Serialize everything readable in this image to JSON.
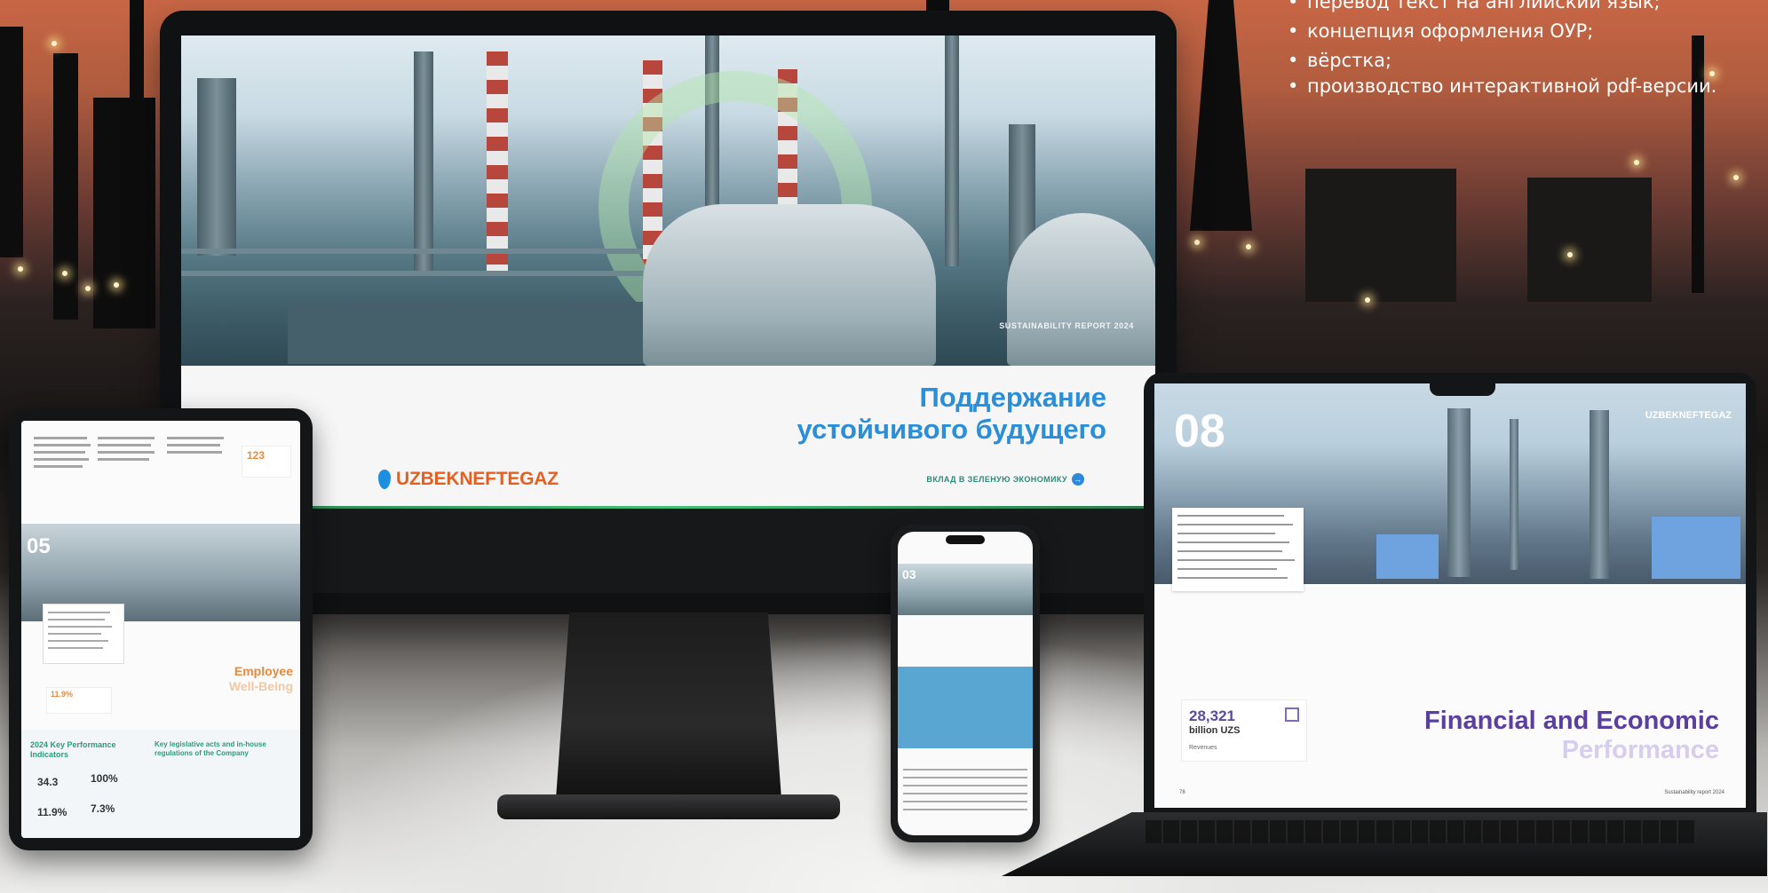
{
  "bullets": [
    "перевод текст на английский язык;",
    "концепция оформления ОУР;",
    "вёрстка;",
    "производство интерактивной pdf-версии."
  ],
  "monitor": {
    "report_label": "SUSTAINABILITY REPORT 2024",
    "headline_1": "Поддержание",
    "headline_2": "устойчивого будущего",
    "logo_text": "UZBEKNEFTEGAZ",
    "link_text": "ВКЛАД В ЗЕЛЕНУЮ ЭКОНОМИКУ"
  },
  "tablet": {
    "stat": "123",
    "section_number": "05",
    "title_1": "Employee",
    "title_2": "Well-Being",
    "box_value": "11.9%",
    "lower_heading": "2024 Key Performance Indicators",
    "lower_heading_2": "Key legislative acts and in-house regulations of the Company",
    "kpis": [
      "34.3",
      "100%",
      "11.9%",
      "7.3%"
    ]
  },
  "phone": {
    "section_number": "03"
  },
  "laptop": {
    "section_number": "08",
    "logo_text": "UZBEKNEFTEGAZ",
    "value": "28,321",
    "unit": "billion UZS",
    "value_label": "Revenues",
    "title_1": "Financial and Economic",
    "title_2": "Performance",
    "footer": "Sustainability report 2024",
    "page": "78"
  },
  "colors": {
    "brand_blue": "#2b8ed9",
    "brand_orange": "#e65f1e",
    "laptop_purple": "#5a3f9e",
    "tablet_orange": "#e8893b"
  }
}
